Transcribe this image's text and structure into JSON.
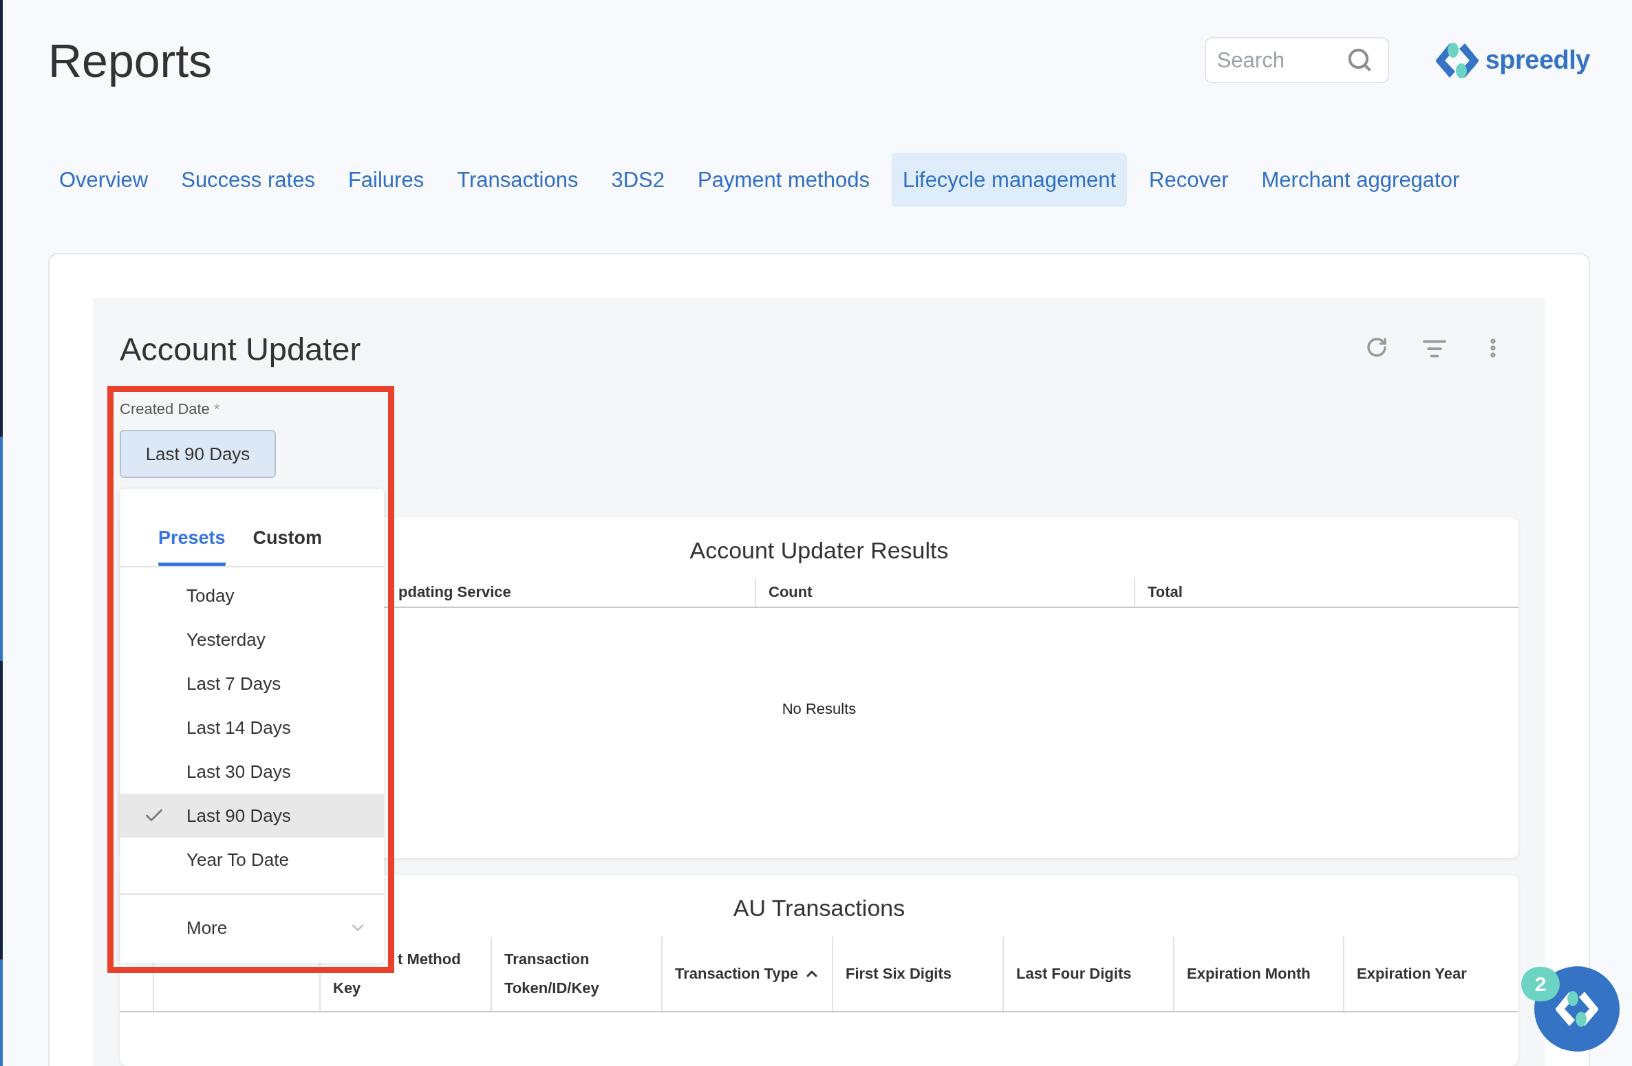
{
  "header": {
    "title": "Reports",
    "search": {
      "placeholder": "Search"
    },
    "brand": "spreedly"
  },
  "tabs": [
    {
      "label": "Overview",
      "selected": false
    },
    {
      "label": "Success rates",
      "selected": false
    },
    {
      "label": "Failures",
      "selected": false
    },
    {
      "label": "Transactions",
      "selected": false
    },
    {
      "label": "3DS2",
      "selected": false
    },
    {
      "label": "Payment methods",
      "selected": false
    },
    {
      "label": "Lifecycle management",
      "selected": true
    },
    {
      "label": "Recover",
      "selected": false
    },
    {
      "label": "Merchant aggregator",
      "selected": false
    }
  ],
  "panel": {
    "title": "Account Updater",
    "date_filter": {
      "label": "Created Date",
      "required_mark": "*",
      "value": "Last 90 Days",
      "popover": {
        "tabs": [
          {
            "label": "Presets",
            "selected": true
          },
          {
            "label": "Custom",
            "selected": false
          }
        ],
        "presets": [
          {
            "label": "Today",
            "selected": false
          },
          {
            "label": "Yesterday",
            "selected": false
          },
          {
            "label": "Last 7 Days",
            "selected": false
          },
          {
            "label": "Last 14 Days",
            "selected": false
          },
          {
            "label": "Last 30 Days",
            "selected": false
          },
          {
            "label": "Last 90 Days",
            "selected": true
          },
          {
            "label": "Year To Date",
            "selected": false
          }
        ],
        "more": "More"
      }
    },
    "results": {
      "title": "Account Updater Results",
      "columns": [
        "pdating Service",
        "Count",
        "Total"
      ],
      "empty": "No Results"
    },
    "transactions": {
      "title": "AU Transactions",
      "columns": [
        {
          "lines": [
            "t Method",
            "Key"
          ]
        },
        {
          "lines": [
            "Transaction",
            "Token/ID/Key"
          ]
        },
        {
          "lines": [
            "Transaction Type"
          ],
          "sorted": true
        },
        {
          "lines": [
            "First Six Digits"
          ]
        },
        {
          "lines": [
            "Last Four Digits"
          ]
        },
        {
          "lines": [
            "Expiration Month"
          ]
        },
        {
          "lines": [
            "Expiration Year"
          ]
        }
      ]
    }
  },
  "chat": {
    "badge": "2"
  }
}
